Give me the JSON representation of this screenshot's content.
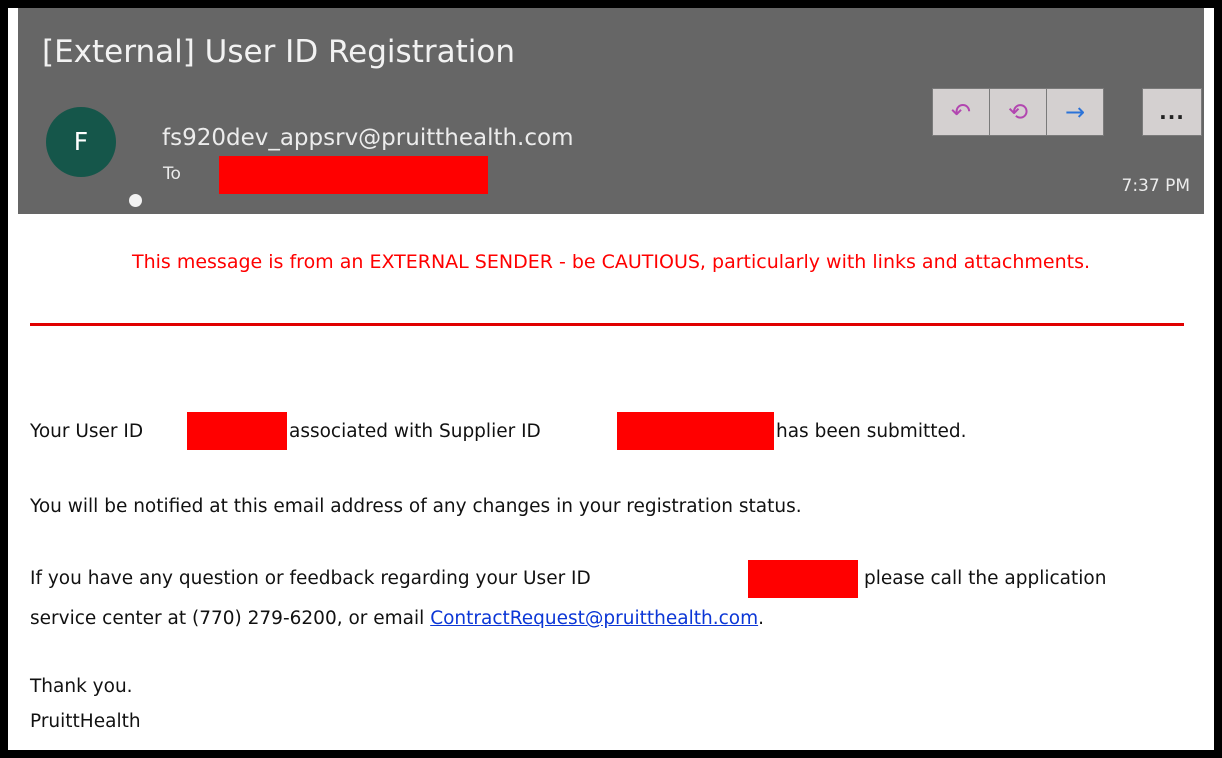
{
  "email": {
    "subject": "[External] User ID Registration",
    "avatar_initial": "F",
    "sender": "fs920dev_appsrv@pruitthealth.com",
    "to_label": "To",
    "time": "7:37 PM"
  },
  "actions": {
    "reply_icon": "reply-icon",
    "reply_all_icon": "reply-all-icon",
    "forward_icon": "forward-icon",
    "more_label": "..."
  },
  "warning": {
    "text": "This message is from an EXTERNAL SENDER - be CAUTIOUS, particularly with links and attachments."
  },
  "body": {
    "p1_a": "Your User ID",
    "p1_b": "associated with Supplier ID",
    "p1_c": "has been submitted.",
    "p2": "You will be notified at this email address of any changes in your registration status.",
    "p3_a": "If you have any question or feedback regarding your User ID",
    "p3_b": "please call the application",
    "p3_c": "service center at (770) 279-6200, or email ",
    "p3_link": "ContractRequest@pruitthealth.com",
    "p3_d": ".",
    "closing": "Thank you.",
    "signature": "PruittHealth"
  },
  "colors": {
    "header_bg": "#666666",
    "avatar_bg": "#15564a",
    "warning": "#ff0000",
    "link": "#0b36d6"
  }
}
